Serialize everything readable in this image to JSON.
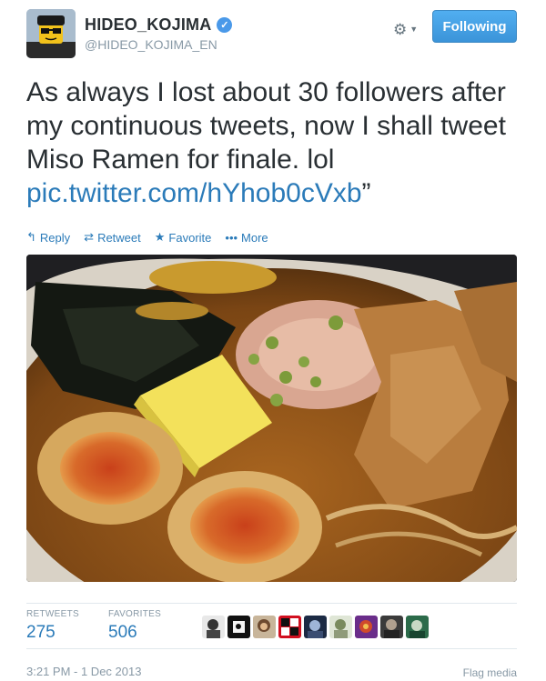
{
  "author": {
    "name": "HIDEO_KOJIMA",
    "handle": "@HIDEO_KOJIMA_EN",
    "verified": true
  },
  "header": {
    "settings_icon": "gear-icon",
    "follow_button_label": "Following"
  },
  "tweet": {
    "text": "As always I lost about 30 followers after my continuous tweets, now I shall tweet Miso Ramen for finale. lol ",
    "link": "pic.twitter.com/hYhob0cVxb",
    "trailing": "”"
  },
  "actions": [
    {
      "label": "Reply",
      "icon": "reply-icon"
    },
    {
      "label": "Retweet",
      "icon": "retweet-icon"
    },
    {
      "label": "Favorite",
      "icon": "star-icon"
    },
    {
      "label": "More",
      "icon": "more-icon"
    }
  ],
  "stats": {
    "retweets_label": "RETWEETS",
    "retweets": "275",
    "favorites_label": "FAVORITES",
    "favorites": "506"
  },
  "footer": {
    "timestamp": "3:21 PM - 1 Dec 2013",
    "flag_label": "Flag media"
  },
  "colors": {
    "link": "#2b7bb9",
    "button": "#3b94d9",
    "muted": "#8899a6"
  }
}
